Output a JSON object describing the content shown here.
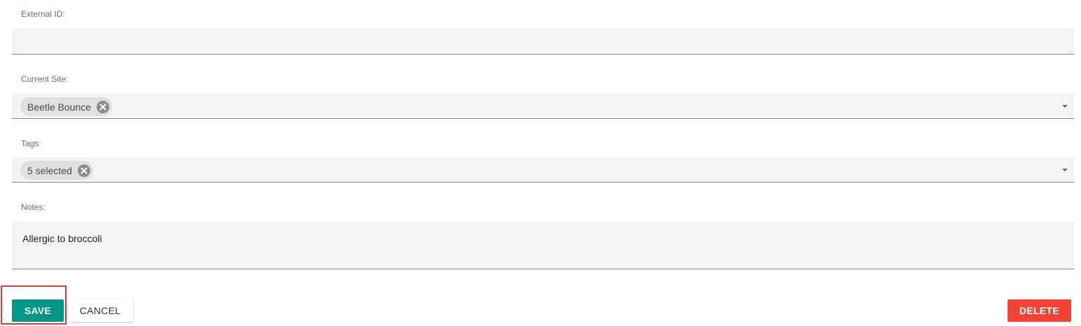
{
  "fields": {
    "external_id": {
      "label": "External ID:",
      "value": ""
    },
    "current_site": {
      "label": "Current Site:",
      "chip_label": "Beetle Bounce"
    },
    "tags": {
      "label": "Tags:",
      "chip_label": "5 selected"
    },
    "notes": {
      "label": "Notes:",
      "value": "Allergic to broccoli"
    }
  },
  "actions": {
    "save_label": "SAVE",
    "cancel_label": "CANCEL",
    "delete_label": "DELETE"
  },
  "colors": {
    "save": "#009688",
    "delete": "#f44336",
    "highlight": "#e53935"
  }
}
